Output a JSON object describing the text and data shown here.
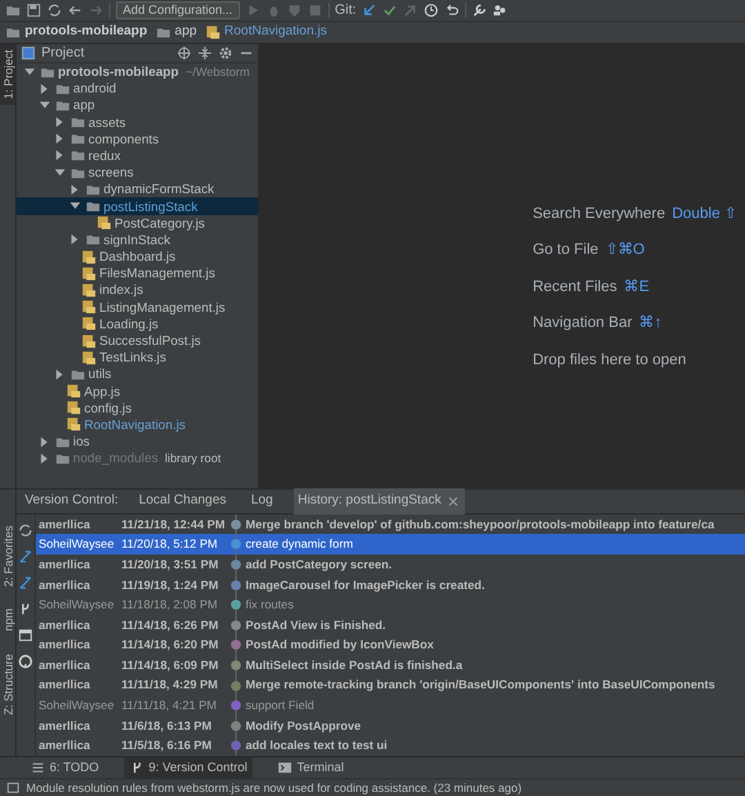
{
  "toolbar": {
    "buttons": [
      {
        "disabled": false
      },
      {
        "disabled": false
      },
      {
        "disabled": false
      },
      {
        "disabled": false
      },
      {
        "disabled": true
      }
    ],
    "configuration": "Add Configuration...",
    "run_buttons": [
      {
        "disabled": true
      },
      {
        "disabled": true
      },
      {
        "disabled": true
      },
      {
        "disabled": true
      }
    ],
    "git_label": "Git:",
    "git_buttons": [
      {
        "disabled": false
      },
      {
        "disabled": false
      },
      {
        "disabled": true
      },
      {
        "disabled": false
      },
      {
        "disabled": false
      },
      {
        "disabled": false
      },
      {
        "disabled": false
      }
    ]
  },
  "breadcrumbs": [
    {
      "label": "protools-mobileapp",
      "kind": "folder"
    },
    {
      "label": "app",
      "kind": "folder"
    },
    {
      "label": "RootNavigation.js",
      "kind": "file"
    }
  ],
  "left_strip": [
    {
      "label": "1: Project",
      "selected": true
    }
  ],
  "project_panel": {
    "title": "Project",
    "tree": [
      {
        "label": "protools-mobileapp",
        "note": "~/Webstorm",
        "kind": "folder",
        "expanded": true,
        "selected": false,
        "bold": true,
        "children": [
          {
            "label": "android",
            "kind": "folder",
            "expanded": false,
            "selected": false
          },
          {
            "label": "app",
            "kind": "folder",
            "expanded": true,
            "selected": false,
            "children": [
              {
                "label": "assets",
                "kind": "folder",
                "expanded": false,
                "selected": false
              },
              {
                "label": "components",
                "kind": "folder",
                "expanded": false,
                "selected": false
              },
              {
                "label": "redux",
                "kind": "folder",
                "expanded": false,
                "selected": false
              },
              {
                "label": "screens",
                "kind": "folder",
                "expanded": true,
                "selected": false,
                "children": [
                  {
                    "label": "dynamicFormStack",
                    "kind": "folder",
                    "expanded": false,
                    "selected": false
                  },
                  {
                    "label": "postListingStack",
                    "kind": "folder",
                    "expanded": true,
                    "selected": true,
                    "children": [
                      {
                        "label": "PostCategory.js",
                        "kind": "file",
                        "selected": false
                      }
                    ]
                  },
                  {
                    "label": "signInStack",
                    "kind": "folder",
                    "expanded": false,
                    "selected": false
                  },
                  {
                    "label": "Dashboard.js",
                    "kind": "file",
                    "selected": false
                  },
                  {
                    "label": "FilesManagement.js",
                    "kind": "file",
                    "selected": false
                  },
                  {
                    "label": "index.js",
                    "kind": "file",
                    "selected": false
                  },
                  {
                    "label": "ListingManagement.js",
                    "kind": "file",
                    "selected": false
                  },
                  {
                    "label": "Loading.js",
                    "kind": "file",
                    "selected": false
                  },
                  {
                    "label": "SuccessfulPost.js",
                    "kind": "file",
                    "selected": false
                  },
                  {
                    "label": "TestLinks.js",
                    "kind": "file",
                    "selected": false
                  }
                ]
              },
              {
                "label": "utils",
                "kind": "folder",
                "expanded": false,
                "selected": false
              },
              {
                "label": "App.js",
                "kind": "file",
                "selected": false
              },
              {
                "label": "config.js",
                "kind": "file",
                "selected": false
              },
              {
                "label": "RootNavigation.js",
                "kind": "file",
                "selected": false,
                "modified": true
              }
            ]
          },
          {
            "label": "ios",
            "kind": "folder",
            "expanded": false,
            "selected": false
          },
          {
            "label": "node_modules",
            "note": "library root",
            "kind": "folder",
            "expanded": false,
            "selected": false,
            "excluded": true
          }
        ]
      }
    ]
  },
  "editor_hints": [
    {
      "label": "Search Everywhere",
      "shortcut": "Double ⇧"
    },
    {
      "label": "Go to File",
      "shortcut": "⇧⌘O"
    },
    {
      "label": "Recent Files",
      "shortcut": "⌘E"
    },
    {
      "label": "Navigation Bar",
      "shortcut": "⌘↑"
    },
    {
      "label": "Drop files here to open"
    }
  ],
  "version_control": {
    "label": "Version Control:",
    "tabs": [
      {
        "label": "Local Changes",
        "selected": false
      },
      {
        "label": "Log",
        "selected": false
      },
      {
        "label": "History: postListingStack",
        "selected": true
      }
    ],
    "side_strip": [
      {
        "label": "2: Favorites"
      },
      {
        "label": "npm"
      },
      {
        "label": "Z: Structure"
      }
    ],
    "commits": [
      {
        "author": "amerllica",
        "date": "11/21/18, 12:44 PM",
        "message": "Merge branch 'develop' of github.com:sheypoor/protools-mobileapp into feature/ca",
        "bold": true,
        "selected": false,
        "color": "#7a8ea0"
      },
      {
        "author": "SoheilWaysee",
        "date": "11/20/18, 5:12 PM",
        "message": "create dynamic form",
        "bold": false,
        "selected": true,
        "color": "#4a90d0"
      },
      {
        "author": "amerllica",
        "date": "11/20/18, 3:51 PM",
        "message": "add PostCategory screen.",
        "bold": true,
        "selected": false,
        "color": "#6a88a0"
      },
      {
        "author": "amerllica",
        "date": "11/19/18, 1:24 PM",
        "message": "ImageCarousel for ImagePicker is created.",
        "bold": true,
        "selected": false,
        "color": "#6a80b0"
      },
      {
        "author": "SoheilWaysee",
        "date": "11/18/18, 2:08 PM",
        "message": "fix routes",
        "bold": false,
        "selected": false,
        "color": "#5aa0a0"
      },
      {
        "author": "amerllica",
        "date": "11/14/18, 6:26 PM",
        "message": "PostAd View is Finished.",
        "bold": true,
        "selected": false,
        "color": "#888888"
      },
      {
        "author": "amerllica",
        "date": "11/14/18, 6:20 PM",
        "message": "PostAd modified by IconViewBox",
        "bold": true,
        "selected": false,
        "color": "#907090"
      },
      {
        "author": "amerllica",
        "date": "11/14/18, 6:09 PM",
        "message": "MultiSelect inside PostAd is finished.a",
        "bold": true,
        "selected": false,
        "color": "#808878"
      },
      {
        "author": "amerllica",
        "date": "11/11/18, 4:29 PM",
        "message": "Merge remote-tracking branch 'origin/BaseUIComponents' into BaseUIComponents",
        "bold": true,
        "selected": false,
        "color": "#708060"
      },
      {
        "author": "SoheilWaysee",
        "date": "11/11/18, 4:21 PM",
        "message": "support Field",
        "bold": false,
        "selected": false,
        "color": "#8060c0"
      },
      {
        "author": "amerllica",
        "date": "11/6/18, 6:13 PM",
        "message": "Modify PostApprove",
        "bold": true,
        "selected": false,
        "color": "#808080"
      },
      {
        "author": "amerllica",
        "date": "11/5/18, 6:16 PM",
        "message": "add locales text to test ui",
        "bold": true,
        "selected": false,
        "color": "#7060b0"
      }
    ]
  },
  "bottom_tabs": [
    {
      "label": "6: TODO",
      "selected": false
    },
    {
      "label": "9: Version Control",
      "selected": true
    },
    {
      "label": "Terminal",
      "selected": false
    }
  ],
  "status_bar": "Module resolution rules from webstorm.js are now used for coding assistance. (23 minutes ago)"
}
